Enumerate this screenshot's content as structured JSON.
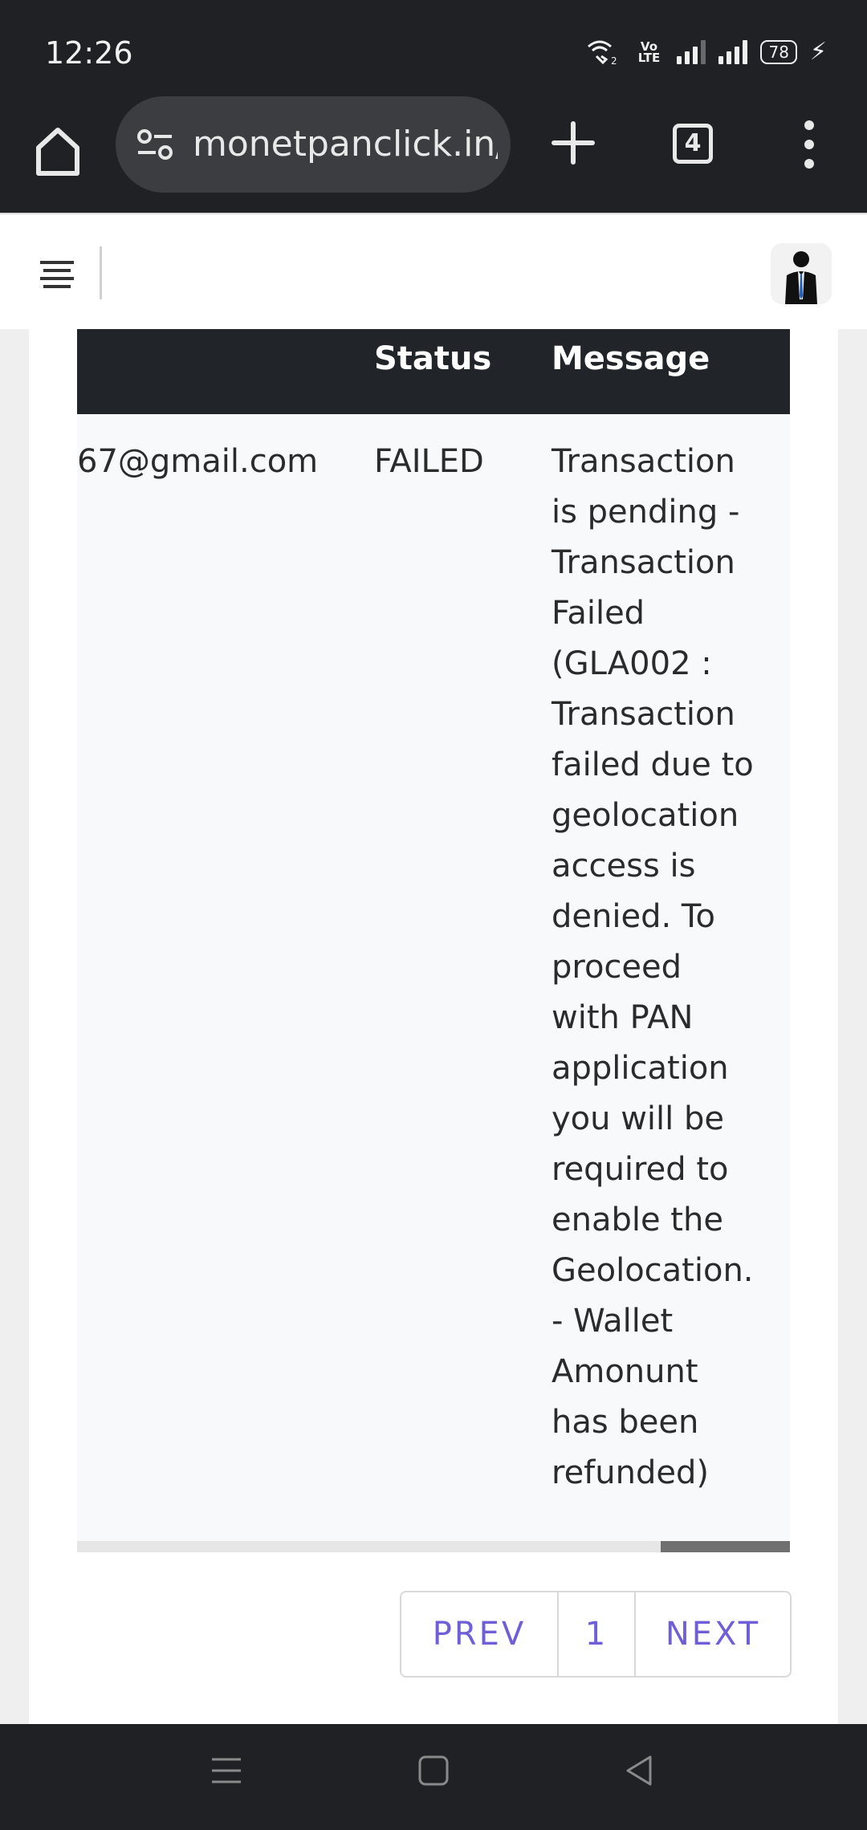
{
  "status_bar": {
    "time": "12:26",
    "volte_label": "Vo LTE",
    "battery_level": "78",
    "icons": [
      "wifi-calling-icon",
      "volte-icon",
      "signal-icon",
      "signal-icon",
      "battery-icon",
      "charging-icon"
    ]
  },
  "browser": {
    "url": "monetpanclick.in/",
    "tab_count": "4",
    "icons": [
      "home-icon",
      "site-settings-icon",
      "new-tab-icon",
      "tab-switcher-icon",
      "more-menu-icon"
    ]
  },
  "site_header": {
    "icons": [
      "hamburger-menu-icon",
      "user-avatar"
    ]
  },
  "table": {
    "columns": [
      "Status",
      "Message"
    ],
    "rows": [
      {
        "email": "67@gmail.com",
        "status": "FAILED",
        "message_lines": [
          "Transaction",
          "is pending -",
          "Transaction",
          "Failed",
          "(GLA002 :",
          "Transaction",
          "failed due to",
          "geolocation",
          "access is",
          "denied. To",
          "proceed",
          "with PAN",
          "application",
          "you will be",
          "required to",
          "enable the",
          "Geolocation.",
          "- Wallet",
          "Amonunt",
          "has been",
          "refunded)"
        ]
      }
    ],
    "horizontal_scroll_fraction": 0.82
  },
  "pagination": {
    "prev_label": "PREV",
    "page_label": "1",
    "next_label": "NEXT"
  },
  "colors": {
    "chrome_dark": "#202124",
    "table_header": "#212529",
    "pagination_text": "#6e5fd8"
  }
}
